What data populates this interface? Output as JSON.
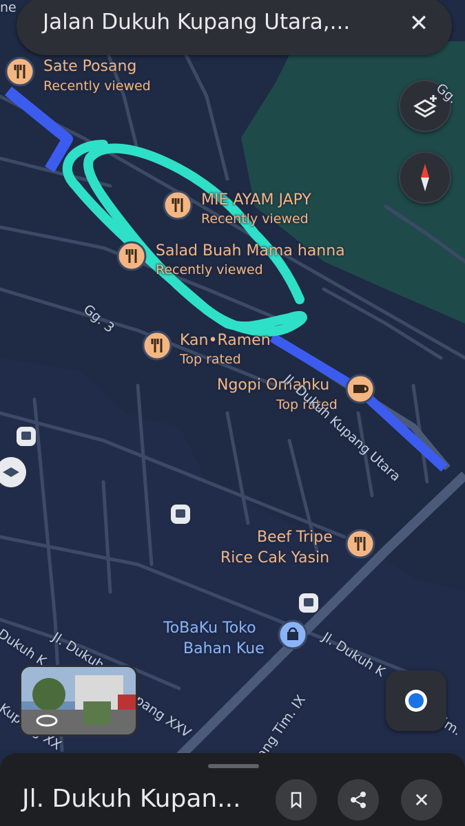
{
  "search": {
    "query": "Jalan Dukuh Kupang Utara,...",
    "close_icon": "close-icon"
  },
  "controls": {
    "layers_icon": "layers-icon",
    "compass_icon": "compass-icon",
    "location_icon": "my-location-icon"
  },
  "colors": {
    "map_bg": "#1f2a44",
    "route": "#3c5cf0",
    "annotation": "#2fe0c8",
    "poi": "#f3b682",
    "poi_blue": "#8ab4f8",
    "water": "#1f4a4a"
  },
  "pois": [
    {
      "name": "Sate Posang",
      "sub": "Recently viewed",
      "icon": "restaurant-icon"
    },
    {
      "name": "MIE AYAM JAPY",
      "sub": "Recently viewed",
      "icon": "restaurant-icon"
    },
    {
      "name": "Salad Buah Mama hanna",
      "sub": "Recently viewed",
      "icon": "restaurant-icon"
    },
    {
      "name": "Kan•Ramen",
      "sub": "Top rated",
      "icon": "restaurant-icon"
    },
    {
      "name": "Ngopi Omahku",
      "sub": "Top rated",
      "icon": "coffee-icon"
    },
    {
      "name": "Beef Tripe",
      "name2": "Rice Cak Yasin",
      "icon": "restaurant-icon"
    },
    {
      "name": "ToBaKu Toko",
      "name2": "Bahan Kue",
      "icon": "shopping-bag-icon"
    }
  ],
  "streets": [
    "Gg. 3",
    "Jl. Dukuh Kupang Utara",
    "Jl. Dukuh K",
    "Dukuh K",
    "pang XXV",
    "Kupang XX",
    "XX",
    "pang Tim. IX",
    "Jl. Dukuh K",
    "im.",
    "Gg.",
    "ne"
  ],
  "bottom_sheet": {
    "title": "Jl. Dukuh Kupan...",
    "save_icon": "bookmark-icon",
    "share_icon": "share-icon",
    "close_icon": "close-icon"
  }
}
